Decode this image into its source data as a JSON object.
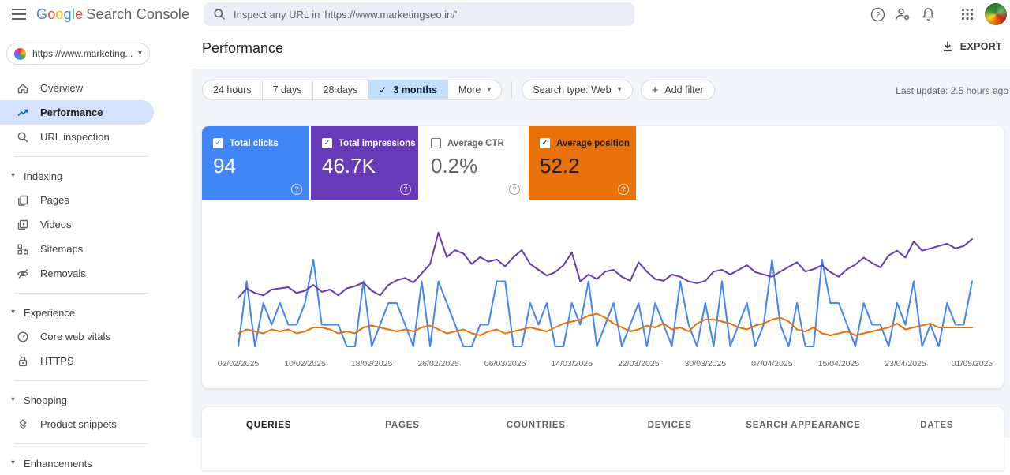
{
  "colors": {
    "clicks": "#4285f4",
    "impressions": "#673ab7",
    "ctr_card": "#ffffff",
    "position": "#e8710a",
    "selected_chip_bg": "#c2e0fc",
    "selected_nav_bg": "#d3e3fd",
    "content_bg": "#f2f5f9"
  },
  "topbar": {
    "logo": {
      "letters": [
        {
          "ch": "G",
          "color": "#4285F4"
        },
        {
          "ch": "o",
          "color": "#EA4335"
        },
        {
          "ch": "o",
          "color": "#FBBC05"
        },
        {
          "ch": "g",
          "color": "#4285F4"
        },
        {
          "ch": "l",
          "color": "#34A853"
        },
        {
          "ch": "e",
          "color": "#EA4335"
        }
      ],
      "rest": "Search Console"
    },
    "search_placeholder": "Inspect any URL in 'https://www.marketingseo.in/'",
    "icons": [
      "menu-icon",
      "search-icon",
      "help-icon",
      "manage-users-icon",
      "notifications-icon",
      "apps-grid-icon",
      "avatar"
    ]
  },
  "sidebar": {
    "property": {
      "url": "https://www.marketing...",
      "icon": "site-favicon"
    },
    "nav": [
      {
        "label": "Overview",
        "icon": "home-icon",
        "selected": false
      },
      {
        "label": "Performance",
        "icon": "performance-icon",
        "selected": true
      },
      {
        "label": "URL inspection",
        "icon": "url-inspection-icon",
        "selected": false
      }
    ],
    "sections": [
      {
        "label": "Indexing",
        "items": [
          {
            "label": "Pages",
            "icon": "pages-icon"
          },
          {
            "label": "Videos",
            "icon": "videos-icon"
          },
          {
            "label": "Sitemaps",
            "icon": "sitemaps-icon"
          },
          {
            "label": "Removals",
            "icon": "removals-icon"
          }
        ]
      },
      {
        "label": "Experience",
        "items": [
          {
            "label": "Core web vitals",
            "icon": "core-web-vitals-icon"
          },
          {
            "label": "HTTPS",
            "icon": "https-icon"
          }
        ]
      },
      {
        "label": "Shopping",
        "items": [
          {
            "label": "Product snippets",
            "icon": "product-snippets-icon"
          }
        ]
      },
      {
        "label": "Enhancements",
        "items": []
      }
    ]
  },
  "header": {
    "title": "Performance",
    "export_label": "EXPORT"
  },
  "toolbar": {
    "date_ranges": [
      "24 hours",
      "7 days",
      "28 days",
      "3 months",
      "More"
    ],
    "selected_range": "3 months",
    "check_glyph": "✓",
    "caret_glyph": "▾",
    "search_type": "Search type: Web",
    "add_filter": "Add filter",
    "plus_glyph": "+",
    "last_update": "Last update: 2.5 hours ago"
  },
  "metrics": {
    "cards": [
      {
        "label": "Total clicks",
        "value": "94",
        "bg": "#4285f4",
        "checked": true,
        "check_color": "#4285f4"
      },
      {
        "label": "Total impressions",
        "value": "46.7K",
        "bg": "#673ab7",
        "checked": true,
        "check_color": "#673ab7"
      },
      {
        "label": "Average CTR",
        "value": "0.2%",
        "bg": "#ffffff",
        "checked": false,
        "check_color": ""
      },
      {
        "label": "Average position",
        "value": "52.2",
        "bg": "#e8710a",
        "checked": true,
        "check_color": "#202124"
      }
    ],
    "help_glyph": "?"
  },
  "chart_data": {
    "type": "line",
    "days": 89,
    "x_range": [
      "02/02/2025",
      "01/05/2025"
    ],
    "x_labels": [
      "02/02/2025",
      "10/02/2025",
      "18/02/2025",
      "26/02/2025",
      "06/03/2025",
      "14/03/2025",
      "22/03/2025",
      "30/03/2025",
      "07/04/2025",
      "15/04/2025",
      "23/04/2025",
      "01/05/2025"
    ],
    "x_label_step_days": 8,
    "grid": false,
    "legend": "none",
    "axes": {
      "clicks": [
        0,
        4
      ],
      "impressions": [
        0,
        1000
      ],
      "position": [
        0,
        60
      ],
      "position_inverted": true
    },
    "series": [
      {
        "name": "Total clicks",
        "color": "#4285f4",
        "axis": "clicks",
        "values": [
          0,
          3,
          0,
          2,
          1,
          2,
          1,
          1,
          2,
          4,
          1,
          1,
          1,
          0,
          0,
          3,
          0,
          1,
          2,
          2,
          1,
          0,
          3,
          0,
          3,
          2,
          1,
          0,
          0,
          1,
          1,
          3,
          3,
          0,
          0,
          2,
          1,
          2,
          0,
          0,
          2,
          1,
          3,
          0,
          1,
          2,
          0,
          1,
          2,
          0,
          2,
          1,
          0,
          3,
          1,
          0,
          2,
          0,
          3,
          0,
          1,
          2,
          0,
          1,
          4,
          1,
          0,
          2,
          0,
          0,
          4,
          2,
          2,
          1,
          0,
          2,
          1,
          1,
          0,
          2,
          1,
          3,
          0,
          1,
          0,
          2,
          1,
          1,
          3
        ]
      },
      {
        "name": "Total impressions",
        "color": "#673ab7",
        "axis": "impressions",
        "values": [
          420,
          500,
          460,
          440,
          490,
          500,
          510,
          460,
          480,
          530,
          470,
          490,
          440,
          500,
          520,
          550,
          480,
          440,
          530,
          570,
          590,
          550,
          630,
          710,
          980,
          770,
          830,
          800,
          710,
          770,
          730,
          750,
          690,
          770,
          830,
          710,
          660,
          610,
          640,
          700,
          810,
          560,
          620,
          580,
          645,
          660,
          600,
          565,
          725,
          645,
          580,
          565,
          620,
          600,
          560,
          545,
          565,
          645,
          660,
          620,
          660,
          700,
          640,
          620,
          600,
          645,
          685,
          725,
          645,
          665,
          700,
          640,
          600,
          665,
          705,
          765,
          720,
          680,
          785,
          825,
          765,
          905,
          825,
          845,
          865,
          885,
          845,
          865,
          925
        ]
      },
      {
        "name": "Average position",
        "color": "#e8710a",
        "axis": "position",
        "values": [
          55,
          53,
          54,
          55,
          53,
          54,
          53,
          55,
          54,
          52,
          52,
          53,
          55,
          54,
          55,
          52,
          51,
          52,
          53,
          54,
          53,
          54,
          52,
          51,
          53,
          55,
          54,
          53,
          55,
          56,
          54,
          53,
          55,
          54,
          53,
          52,
          53,
          54,
          52,
          50,
          49,
          48,
          46,
          45,
          47,
          50,
          52,
          54,
          53,
          51,
          52,
          50,
          53,
          52,
          54,
          50,
          48,
          48,
          49,
          50,
          52,
          53,
          51,
          50,
          48,
          47,
          49,
          53,
          54,
          52,
          55,
          56,
          55,
          54,
          56,
          55,
          54,
          53,
          52,
          50,
          53,
          52,
          51,
          50,
          52,
          52,
          52,
          52,
          52
        ]
      }
    ],
    "totals": {
      "clicks": "94",
      "impressions": "46.7K",
      "ctr": "0.2%",
      "position": "52.2"
    }
  },
  "tabs": {
    "items": [
      "QUERIES",
      "PAGES",
      "COUNTRIES",
      "DEVICES",
      "SEARCH APPEARANCE",
      "DATES"
    ],
    "active_index": 0
  }
}
